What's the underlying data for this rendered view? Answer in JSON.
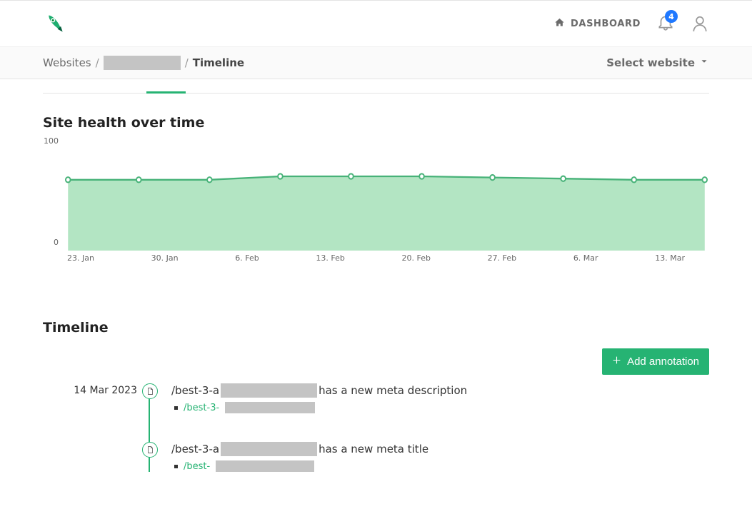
{
  "header": {
    "dashboard_label": "DASHBOARD",
    "notifications_count": "4"
  },
  "breadcrumb": {
    "root": "Websites",
    "leaf": "Timeline",
    "select_label": "Select website"
  },
  "chart_section_title": "Site health over time",
  "chart_data": {
    "type": "area",
    "ylabel": "",
    "xlabel": "",
    "ylim": [
      0,
      100
    ],
    "y_ticks": [
      "100",
      "0"
    ],
    "categories": [
      "23. Jan",
      "30. Jan",
      "6. Feb",
      "13. Feb",
      "20. Feb",
      "27. Feb",
      "6. Mar",
      "13. Mar"
    ],
    "series": [
      {
        "name": "Site health",
        "values": [
          62,
          62,
          62,
          65,
          65,
          65,
          64,
          63,
          62,
          62
        ]
      }
    ]
  },
  "timeline": {
    "title": "Timeline",
    "add_label": "Add annotation",
    "entries": [
      {
        "date": "14 Mar 2023",
        "title_prefix": "/best-3-a",
        "title_suffix": " has a new meta description",
        "sub_prefix": "/best-3-"
      },
      {
        "date": "",
        "title_prefix": "/best-3-a",
        "title_suffix": " has a new meta title",
        "sub_prefix": "/best-"
      }
    ]
  }
}
